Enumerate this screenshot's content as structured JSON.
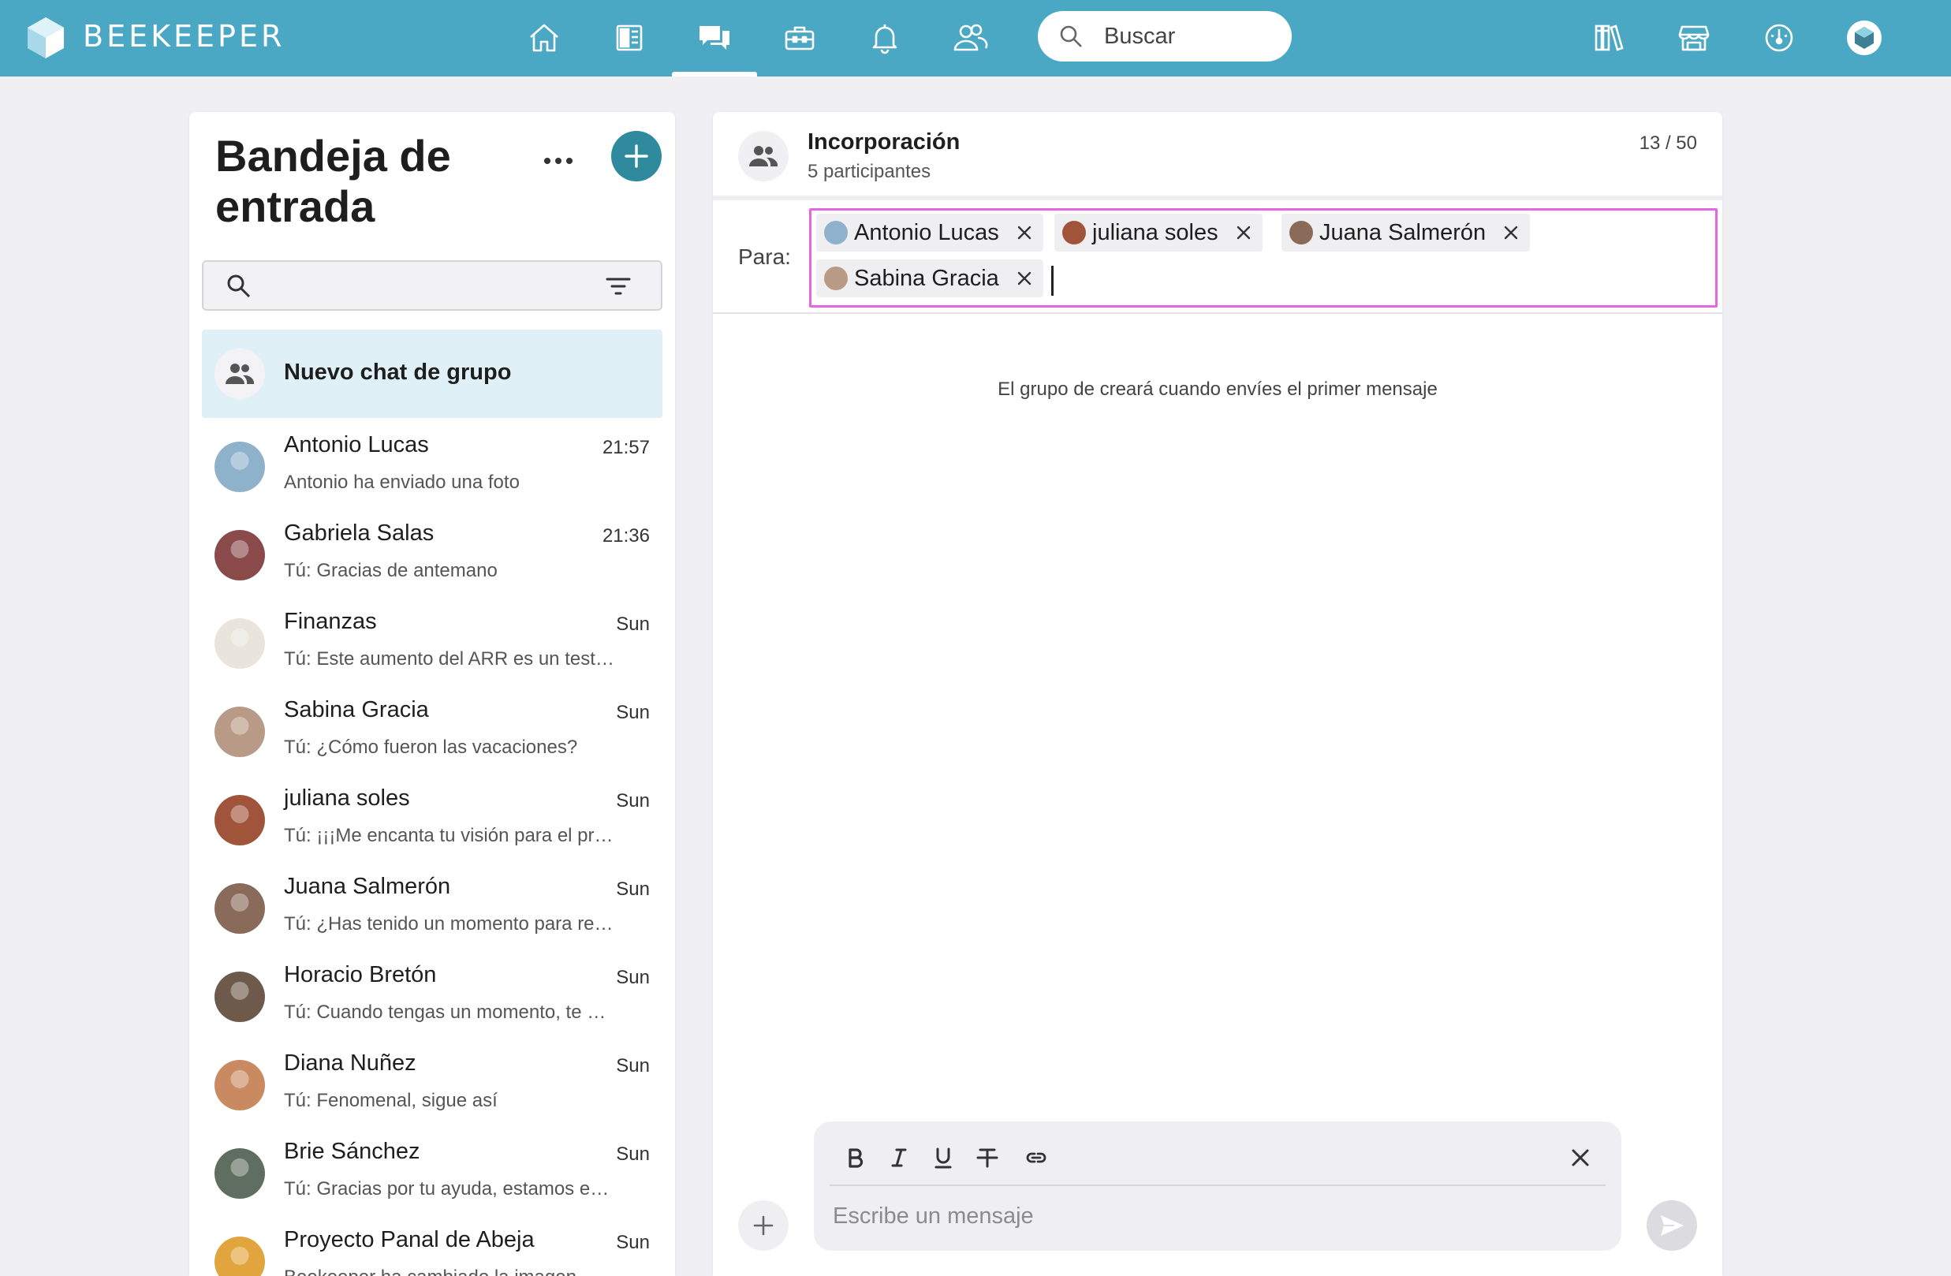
{
  "app": {
    "brand": "BEEKEEPER"
  },
  "colors": {
    "topbar": "#4ba8c4",
    "accent": "#2f8a9e",
    "selection": "#dff0f6",
    "focus_outline": "#e566e3"
  },
  "nav": {
    "icons": [
      "home-icon",
      "news-icon",
      "chat-icon",
      "toolbox-icon",
      "bell-icon",
      "people-icon"
    ],
    "active": "chat-icon",
    "search_placeholder": "Buscar",
    "right_icons": [
      "library-icon",
      "store-icon",
      "dashboard-icon",
      "profile-icon"
    ]
  },
  "inbox": {
    "title": "Bandeja de entrada",
    "new_group_label": "Nuevo chat de grupo",
    "conversations": [
      {
        "name": "Antonio Lucas",
        "time": "21:57",
        "preview": "Antonio ha enviado una foto",
        "avatar_color": "#8fb2cc"
      },
      {
        "name": "Gabriela Salas",
        "time": "21:36",
        "preview": "Tú: Gracias de antemano",
        "avatar_color": "#8a4a4a"
      },
      {
        "name": "Finanzas",
        "time": "Sun",
        "preview": "Tú: Este aumento del ARR es un testimonio del trabajo",
        "avatar_color": "#e9e4dc"
      },
      {
        "name": "Sabina Gracia",
        "time": "Sun",
        "preview": "Tú: ¿Cómo fueron las vacaciones?",
        "avatar_color": "#b89a86"
      },
      {
        "name": "juliana soles",
        "time": "Sun",
        "preview": "Tú: ¡¡¡Me encanta tu visión para el proyecto!!!",
        "avatar_color": "#a0553a"
      },
      {
        "name": "Juana Salmerón",
        "time": "Sun",
        "preview": "Tú: ¿Has tenido un momento para revisar",
        "avatar_color": "#8a6a58"
      },
      {
        "name": "Horacio Bretón",
        "time": "Sun",
        "preview": "Tú: Cuando tengas un momento, te agradecería",
        "avatar_color": "#6e5a4a"
      },
      {
        "name": "Diana Nuñez",
        "time": "Sun",
        "preview": "Tú: Fenomenal, sigue así",
        "avatar_color": "#c98a62"
      },
      {
        "name": "Brie Sánchez",
        "time": "Sun",
        "preview": "Tú: Gracias por tu ayuda, estamos encantados",
        "avatar_color": "#5f6e60"
      },
      {
        "name": "Proyecto Panal de Abeja",
        "time": "Sun",
        "preview": "Beekeeper ha cambiado la imagen",
        "avatar_color": "#e2a43c"
      }
    ]
  },
  "chat": {
    "title": "Incorporación",
    "participants": "5 participantes",
    "char_count": "13 / 50",
    "to_label": "Para:",
    "recipients": [
      {
        "name": "Antonio Lucas",
        "avatar_color": "#8fb2cc"
      },
      {
        "name": "juliana soles",
        "avatar_color": "#a0553a"
      },
      {
        "name": "Juana Salmerón",
        "avatar_color": "#8a6a58"
      },
      {
        "name": "Sabina Gracia",
        "avatar_color": "#b89a86"
      }
    ],
    "empty_note": "El grupo de creará cuando envíes el primer mensaje",
    "composer": {
      "placeholder": "Escribe un mensaje",
      "format_buttons": [
        "bold-icon",
        "italic-icon",
        "underline-icon",
        "strikethrough-icon",
        "link-icon"
      ]
    }
  }
}
